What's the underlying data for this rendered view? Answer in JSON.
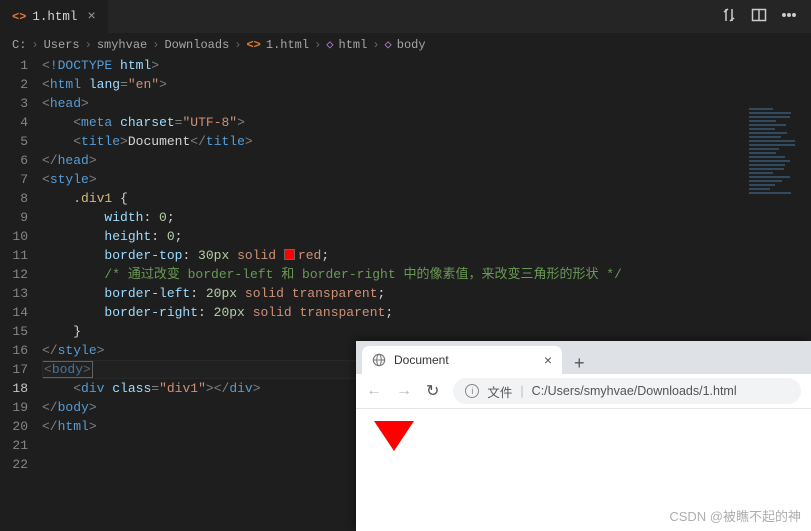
{
  "tab": {
    "filename": "1.html"
  },
  "breadcrumbs": [
    "C:",
    "Users",
    "smyhvae",
    "Downloads",
    "1.html",
    "html",
    "body"
  ],
  "code": {
    "lines": [
      {
        "n": 1,
        "t": "doctype",
        "text": "!DOCTYPE",
        "attr": "html"
      },
      {
        "n": 2,
        "t": "open",
        "tag": "html",
        "attrs": [
          [
            "lang",
            "en"
          ]
        ]
      },
      {
        "n": 3,
        "t": "open",
        "tag": "head"
      },
      {
        "n": 4,
        "t": "self",
        "tag": "meta",
        "attrs": [
          [
            "charset",
            "UTF-8"
          ]
        ],
        "indent": 2
      },
      {
        "n": 5,
        "t": "pair",
        "tag": "title",
        "inner": "Document",
        "indent": 2
      },
      {
        "n": 6,
        "t": "close",
        "tag": "head"
      },
      {
        "n": 7,
        "t": "open",
        "tag": "style"
      },
      {
        "n": 8,
        "t": "css-sel",
        "text": ".div1 {",
        "indent": 2
      },
      {
        "n": 9,
        "t": "css-prop",
        "prop": "width",
        "val": "0",
        "indent": 4
      },
      {
        "n": 10,
        "t": "css-prop",
        "prop": "height",
        "val": "0",
        "indent": 4
      },
      {
        "n": 11,
        "t": "css-prop",
        "prop": "border-top",
        "val": "30px solid red",
        "swatch": true,
        "indent": 4
      },
      {
        "n": 12,
        "t": "css-comm",
        "text": "/* 通过改变 border-left 和 border-right 中的像素值，来改变三角形的形状 */",
        "indent": 4
      },
      {
        "n": 13,
        "t": "css-prop",
        "prop": "border-left",
        "val": "20px solid transparent",
        "indent": 4
      },
      {
        "n": 14,
        "t": "css-prop",
        "prop": "border-right",
        "val": "20px solid transparent",
        "indent": 4
      },
      {
        "n": 15,
        "t": "raw",
        "text": "}",
        "indent": 2
      },
      {
        "n": 16,
        "t": "close",
        "tag": "style"
      },
      {
        "n": 17,
        "t": "blank"
      },
      {
        "n": 18,
        "t": "cursor-open",
        "tag": "body"
      },
      {
        "n": 19,
        "t": "self",
        "tag": "div",
        "attrs": [
          [
            "class",
            "div1"
          ]
        ],
        "closed": true,
        "indent": 2
      },
      {
        "n": 20,
        "t": "close",
        "tag": "body"
      },
      {
        "n": 21,
        "t": "blank"
      },
      {
        "n": 22,
        "t": "close",
        "tag": "html"
      }
    ],
    "current": 18
  },
  "browser": {
    "tab_title": "Document",
    "url_label": "文件",
    "url_path": "C:/Users/smyhvae/Downloads/1.html"
  },
  "watermark": "CSDN @被瞧不起的神"
}
